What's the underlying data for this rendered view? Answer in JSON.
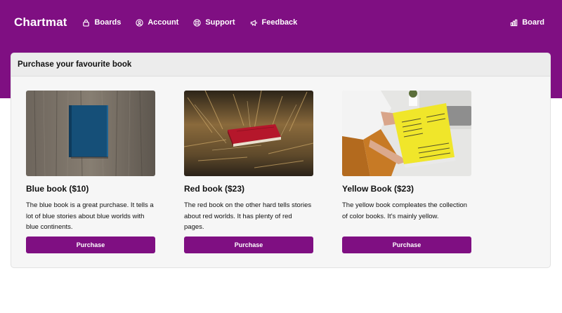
{
  "brand": "Chartmat",
  "nav": {
    "items": [
      {
        "label": "Boards",
        "icon": "lock-icon"
      },
      {
        "label": "Account",
        "icon": "user-circle-icon"
      },
      {
        "label": "Support",
        "icon": "lifebuoy-icon"
      },
      {
        "label": "Feedback",
        "icon": "megaphone-icon"
      }
    ],
    "right": {
      "label": "Board",
      "icon": "bar-chart-icon"
    }
  },
  "colors": {
    "brand": "#7f0f82",
    "card_bg": "#f6f6f6",
    "header_bg": "#ececec"
  },
  "panel": {
    "title": "Purchase your favourite book"
  },
  "products": [
    {
      "title": "Blue book ($10)",
      "description": "The blue book is a great purchase. It tells a lot of blue stories about blue worlds with blue continents.",
      "button": "Purchase",
      "image": "blue-book-photo"
    },
    {
      "title": "Red book ($23)",
      "description": "The red book on the other hard tells stories about red worlds. It has plenty of red pages.",
      "button": "Purchase",
      "image": "red-book-photo"
    },
    {
      "title": "Yellow Book ($23)",
      "description": "The yellow book compleates the collection of color books. It's mainly yellow.",
      "button": "Purchase",
      "image": "yellow-book-photo"
    }
  ]
}
